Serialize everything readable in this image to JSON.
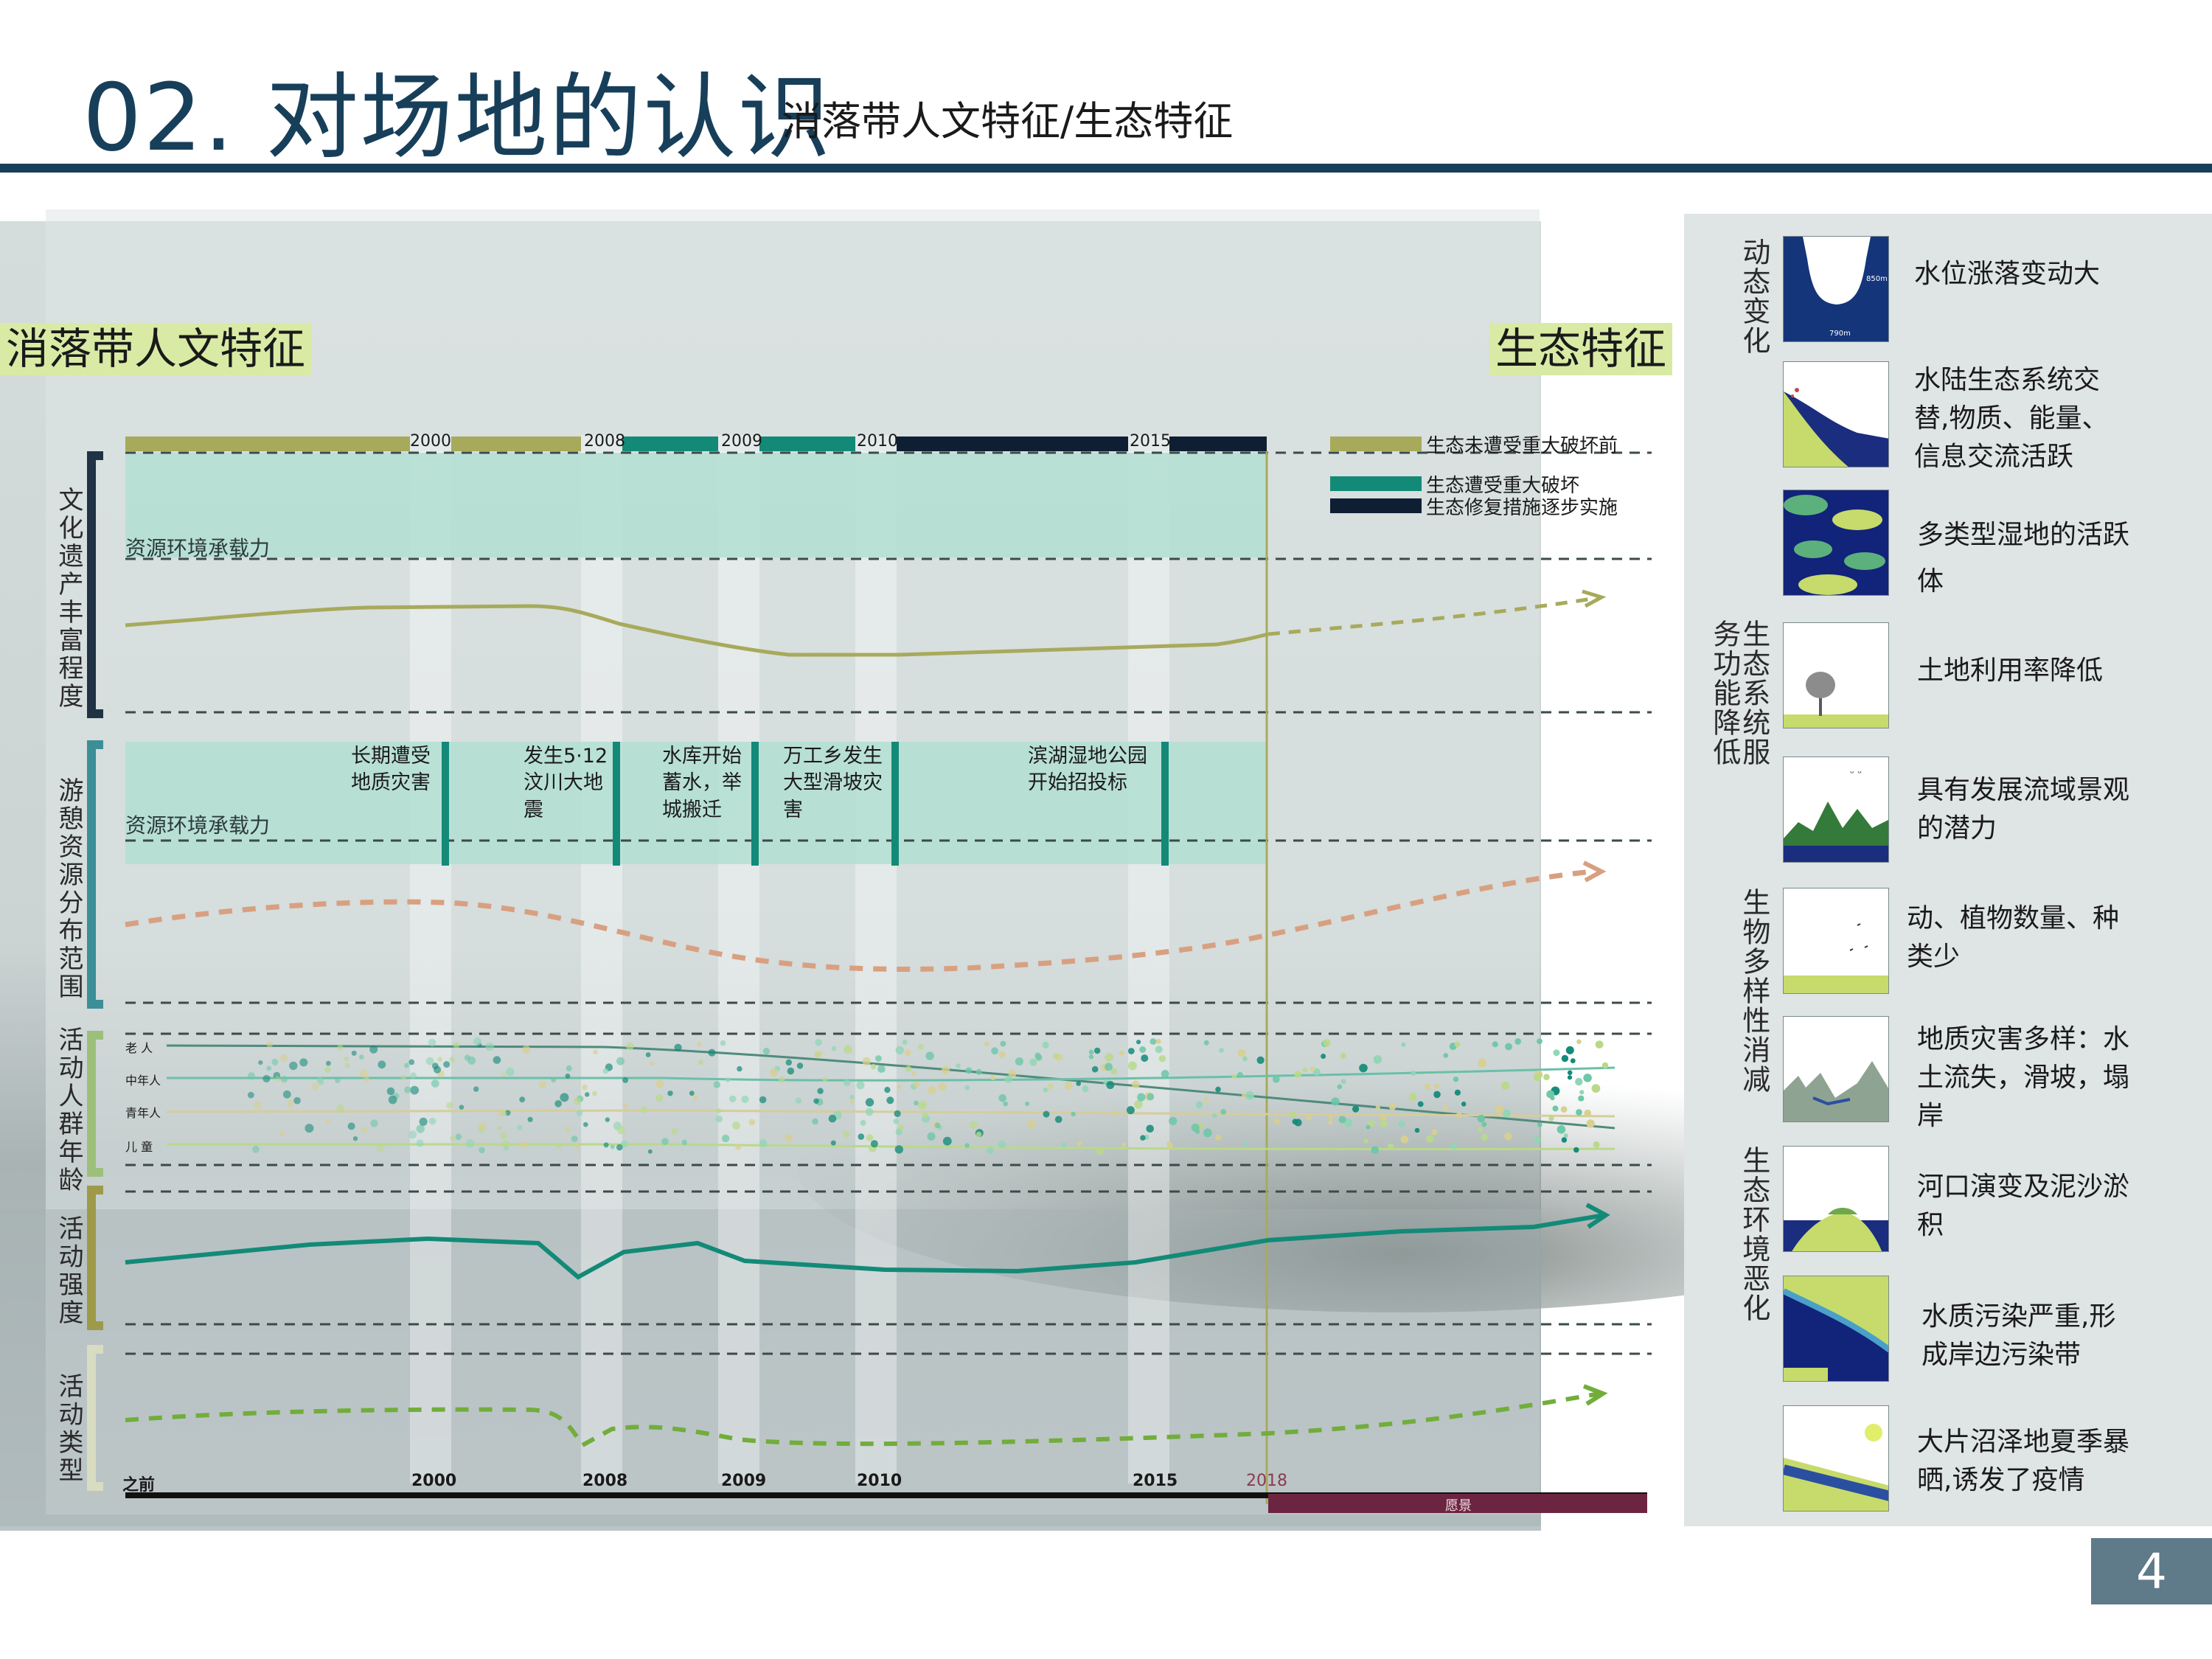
{
  "header": {
    "title": "02. 对场地的认识",
    "subtitle": "消落带人文特征/生态特征"
  },
  "page_number": "4",
  "left_label": "消落带人文特征",
  "right_label": "生态特征",
  "timeline_top": {
    "years": [
      "2000",
      "2008",
      "2009",
      "2010",
      "2015"
    ],
    "phases": [
      {
        "label": "生态未遭受重大破坏前",
        "color": "#a7aa5b"
      },
      {
        "label": "生态遭受重大破坏",
        "color": "#138a78"
      },
      {
        "label": "生态修复措施逐步实施",
        "color": "#0f1f33"
      }
    ]
  },
  "rows": {
    "culture": {
      "label": "文化遗产丰富程度",
      "capacity": "资源环境承载力"
    },
    "recreation": {
      "label": "游憩资源分布范围",
      "capacity": "资源环境承载力"
    },
    "age": {
      "label": "活动人群年龄",
      "groups": [
        "老 人",
        "中年人",
        "青年人",
        "儿 童"
      ]
    },
    "intensity": {
      "label": "活动强度"
    },
    "type": {
      "label": "活动类型"
    }
  },
  "events": [
    "长期遭受地质灾害",
    "发生5·12汶川大地震",
    "水库开始蓄水，举城搬迁",
    "万工乡发生大型滑坡灾害",
    "滨湖湿地公园开始招投标"
  ],
  "timeline_bottom": {
    "ticks": [
      "之前",
      "2000",
      "2008",
      "2009",
      "2010",
      "2015",
      "2018"
    ],
    "future_label": "愿景"
  },
  "right_panel": {
    "groups": [
      "动态变化",
      "生态系统服务功能降低",
      "生物多样性消减",
      "生态环境恶化"
    ],
    "icon_texts": {
      "depth_top": "850m",
      "depth_bottom": "790m"
    },
    "items": [
      "水位涨落变动大",
      "水陆生态系统交替,物质、能量、信息交流活跃",
      "多类型湿地的活跃体",
      "土地利用率降低",
      "具有发展流域景观的潜力",
      "动、植物数量、种类少",
      "地质灾害多样：水土流失，滑坡，塌岸",
      "河口演变及泥沙淤积",
      "水质污染严重,形成岸边污染带",
      "大片沼泽地夏季暴晒,诱发了疫情"
    ]
  },
  "colors": {
    "navy": "#173f5a",
    "olive": "#a7aa5b",
    "teal": "#138a78",
    "dark": "#0f1f33",
    "mint": "#b3dfd2",
    "salmon": "#d8a080",
    "green": "#72ad3c",
    "wine": "#6c2540",
    "lime": "#d9eaa5"
  }
}
